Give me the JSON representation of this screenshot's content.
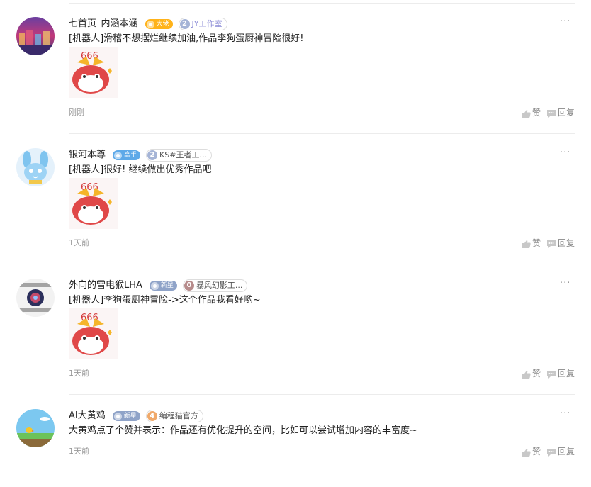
{
  "comments": [
    {
      "username": "七首页_内涵本涵",
      "level_badge": "大佬",
      "level_color": "#ffb31a",
      "studio_num": "2",
      "studio_name": "JY工作室",
      "studio_color": "#a5b4d6",
      "studio_text_color": "#8b8bd6",
      "text": "[机器人]滑稽不想摆烂继续加油,作品李狗蛋厨神冒险很好!",
      "sticker_label": "666",
      "time": "刚刚",
      "like_label": "赞",
      "reply_label": "回复",
      "more_label": "···",
      "avatar_icon": "city-night-avatar"
    },
    {
      "username": "银河本尊",
      "level_badge": "高手",
      "level_color": "#5ea9e8",
      "studio_num": "2",
      "studio_name": "KS#王者工...",
      "studio_color": "#a5b4d6",
      "studio_text_color": "#555555",
      "text": "[机器人]很好!  继续做出优秀作品吧",
      "sticker_label": "666",
      "time": "1天前",
      "like_label": "赞",
      "reply_label": "回复",
      "more_label": "···",
      "avatar_icon": "blue-bunny-avatar"
    },
    {
      "username": "外向的雷电猴LHA",
      "level_badge": "新星",
      "level_color": "#8fa3c8",
      "studio_num": "0",
      "studio_name": "暴风幻影工...",
      "studio_color": "#b78c8c",
      "studio_text_color": "#555555",
      "text": "[机器人]李狗蛋厨神冒险->这个作品我看好哟~",
      "sticker_label": "666",
      "time": "1天前",
      "like_label": "赞",
      "reply_label": "回复",
      "more_label": "···",
      "avatar_icon": "studio-logo-avatar"
    },
    {
      "username": "AI大黄鸡",
      "level_badge": "新星",
      "level_color": "#8fa3c8",
      "studio_num": "4",
      "studio_name": "编程猫官方",
      "studio_color": "#f0a96a",
      "studio_text_color": "#555555",
      "text": "大黄鸡点了个赞并表示：作品还有优化提升的空间，比如可以尝试增加内容的丰富度~",
      "sticker_label": "",
      "time": "1天前",
      "like_label": "赞",
      "reply_label": "回复",
      "more_label": "···",
      "avatar_icon": "yellow-chick-avatar"
    }
  ]
}
